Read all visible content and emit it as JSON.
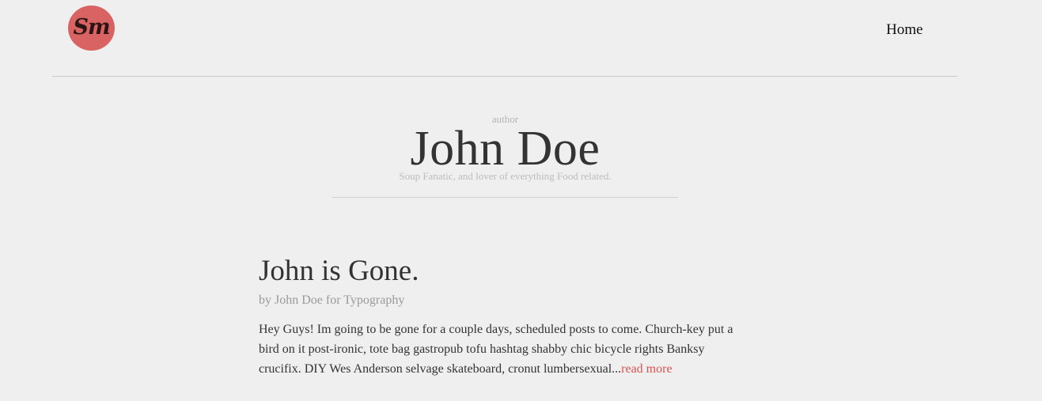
{
  "header": {
    "logo_text": "Sm",
    "logo_color": "#d96262",
    "nav": {
      "home_label": "Home"
    }
  },
  "author": {
    "kicker": "author",
    "name": "John Doe",
    "bio": "Soup Fanatic, and lover of everything Food related."
  },
  "post": {
    "title": "John is Gone.",
    "meta": "by John Doe for Typography",
    "excerpt": "Hey Guys! Im going to be gone for a couple days, scheduled posts to come. Church-key put a bird on it post-ironic, tote bag gastropub tofu hashtag shabby chic bicycle rights Banksy crucifix. DIY Wes Anderson selvage skateboard, cronut lumbersexual...",
    "read_more_label": "read more",
    "read_more_color": "#d9534f"
  }
}
